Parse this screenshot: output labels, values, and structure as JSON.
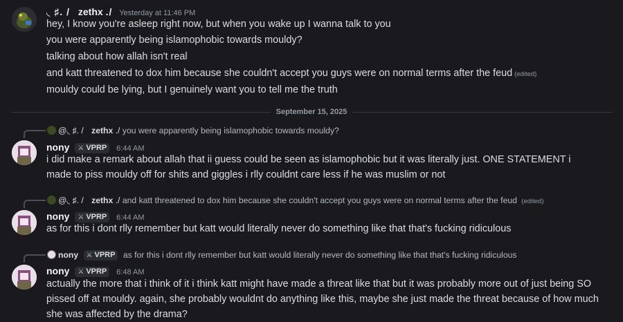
{
  "first_message": {
    "author": "zethx",
    "author_prefix": "◟ ♯. /",
    "author_suffix": "./",
    "timestamp": "Yesterday at 11:46 PM",
    "lines": [
      "hey, I know you're asleep right now, but when you wake up I wanna talk to you",
      "you were apparently being islamophobic towards mouldy?",
      "talking about how allah isn't real",
      "and katt threatened to dox him because she couldn't accept you guys were on normal terms after the feud",
      "mouldy could be lying, but I genuinely want you to tell me the truth"
    ],
    "edited_label": "(edited)"
  },
  "date_divider": "September 15, 2025",
  "replies": [
    {
      "reply_prefix": "@◟ ♯. /",
      "reply_author": "zethx",
      "reply_suffix": "./",
      "reply_text": "you were apparently being islamophobic towards mouldy?",
      "reply_edited": "",
      "author": "nony",
      "badge": "VPRP",
      "timestamp": "6:44 AM",
      "text": "i did make a remark about allah that  ii guess could be seen as islamophobic but it was literally just. ONE STATEMENT i made to piss mouldy off for shits and giggles i rlly couldnt care less if he was muslim or not"
    },
    {
      "reply_prefix": "@◟ ♯. /",
      "reply_author": "zethx",
      "reply_suffix": "./",
      "reply_text": "and katt threatened to dox him because she couldn't accept you guys were on normal terms after the feud",
      "reply_edited": "(edited)",
      "author": "nony",
      "badge": "VPRP",
      "timestamp": "6:44 AM",
      "text": "as for this i dont rlly remember but katt would literally never do something like that that's fucking ridiculous"
    },
    {
      "reply_author": "nony",
      "reply_badge": "VPRP",
      "reply_text": "as for this i dont rlly remember but katt would literally never do something like that that's fucking ridiculous",
      "author": "nony",
      "badge": "VPRP",
      "timestamp": "6:48 AM",
      "text": "actually the more that i think of it i think katt might have made a threat like that but it was probably more out of just being SO pissed off at mouldy. again, she probably wouldnt do anything like this, maybe she just made the threat because of how much she was affected by the drama?"
    }
  ],
  "colors": {
    "background": "#1a1a1e",
    "text": "#dbdee1",
    "muted": "#949ba4"
  }
}
